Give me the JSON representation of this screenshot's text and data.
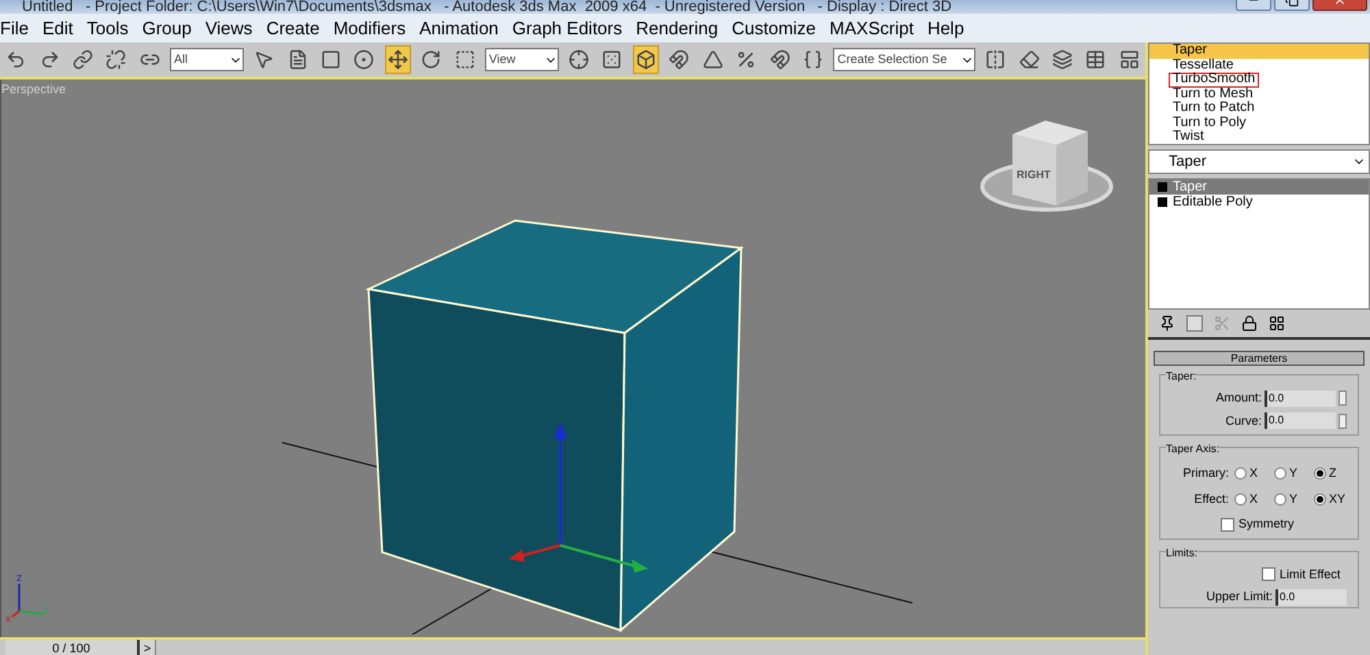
{
  "window": {
    "title": "Untitled   - Project Folder: C:\\Users\\Win7\\Documents\\3dsmax   - Autodesk 3ds Max  2009 x64  - Unregistered Version   - Display : Direct 3D"
  },
  "menu": [
    "File",
    "Edit",
    "Tools",
    "Group",
    "Views",
    "Create",
    "Modifiers",
    "Animation",
    "Graph Editors",
    "Rendering",
    "Customize",
    "MAXScript",
    "Help"
  ],
  "toolbar": [
    {
      "kind": "icon",
      "selected": false
    },
    {
      "kind": "icon",
      "selected": false
    },
    {
      "kind": "icon",
      "selected": false
    },
    {
      "kind": "icon",
      "selected": false
    },
    {
      "kind": "icon",
      "selected": false
    },
    {
      "kind": "dropdown",
      "value": "All"
    },
    {
      "kind": "icon",
      "selected": false
    },
    {
      "kind": "icon",
      "selected": false
    },
    {
      "kind": "icon",
      "selected": false
    },
    {
      "kind": "icon",
      "selected": false
    },
    {
      "kind": "icon",
      "selected": true
    },
    {
      "kind": "icon",
      "selected": false
    },
    {
      "kind": "icon",
      "selected": false
    },
    {
      "kind": "dropdown",
      "value": "View"
    },
    {
      "kind": "icon",
      "selected": false
    },
    {
      "kind": "icon",
      "selected": false
    },
    {
      "kind": "icon",
      "selected": true
    },
    {
      "kind": "icon",
      "selected": false
    },
    {
      "kind": "icon",
      "selected": false
    },
    {
      "kind": "icon",
      "selected": false
    },
    {
      "kind": "icon",
      "selected": false
    },
    {
      "kind": "icon",
      "selected": false
    },
    {
      "kind": "dropdown",
      "value": "Create Selection Se"
    },
    {
      "kind": "icon",
      "selected": false
    },
    {
      "kind": "icon",
      "selected": false
    },
    {
      "kind": "icon",
      "selected": false
    },
    {
      "kind": "icon",
      "selected": false
    },
    {
      "kind": "icon",
      "selected": false
    }
  ],
  "viewport": {
    "label": "Perspective",
    "viewcube_label": "RIGHT",
    "axes": [
      "z",
      "x",
      "y"
    ]
  },
  "modifier_list": {
    "items": [
      {
        "label": "Taper",
        "selected": true,
        "marked": false
      },
      {
        "label": "Tessellate",
        "selected": false,
        "marked": false
      },
      {
        "label": "TurboSmooth",
        "selected": false,
        "marked": true
      },
      {
        "label": "Turn to Mesh",
        "selected": false,
        "marked": false
      },
      {
        "label": "Turn to Patch",
        "selected": false,
        "marked": false
      },
      {
        "label": "Turn to Poly",
        "selected": false,
        "marked": false
      },
      {
        "label": "Twist",
        "selected": false,
        "marked": false
      }
    ],
    "dropdown": "Taper"
  },
  "stack": [
    {
      "label": "Taper",
      "selected": true
    },
    {
      "label": "Editable Poly",
      "selected": false
    }
  ],
  "parameters": {
    "title": "Parameters",
    "taper_group": "Taper:",
    "fields": [
      {
        "label": "Amount:",
        "value": "0.0"
      },
      {
        "label": "Curve:",
        "value": "0.0"
      }
    ],
    "axis_group": "Taper Axis:",
    "axis_rows": [
      {
        "label": "Primary:",
        "options": [
          {
            "label": "X",
            "selected": false
          },
          {
            "label": "Y",
            "selected": false
          },
          {
            "label": "Z",
            "selected": true
          }
        ]
      },
      {
        "label": "Effect:",
        "options": [
          {
            "label": "X",
            "selected": false
          },
          {
            "label": "Y",
            "selected": false
          },
          {
            "label": "XY",
            "selected": true
          }
        ]
      }
    ],
    "symmetry": {
      "label": "Symmetry",
      "checked": false
    },
    "limits_group": "Limits:",
    "limit_effect": {
      "label": "Limit Effect",
      "checked": false
    },
    "upper_limit": {
      "label": "Upper Limit:",
      "value": "0.0"
    }
  },
  "timeline": {
    "frame": "0 / 100",
    "next": ">",
    "level": 0
  }
}
